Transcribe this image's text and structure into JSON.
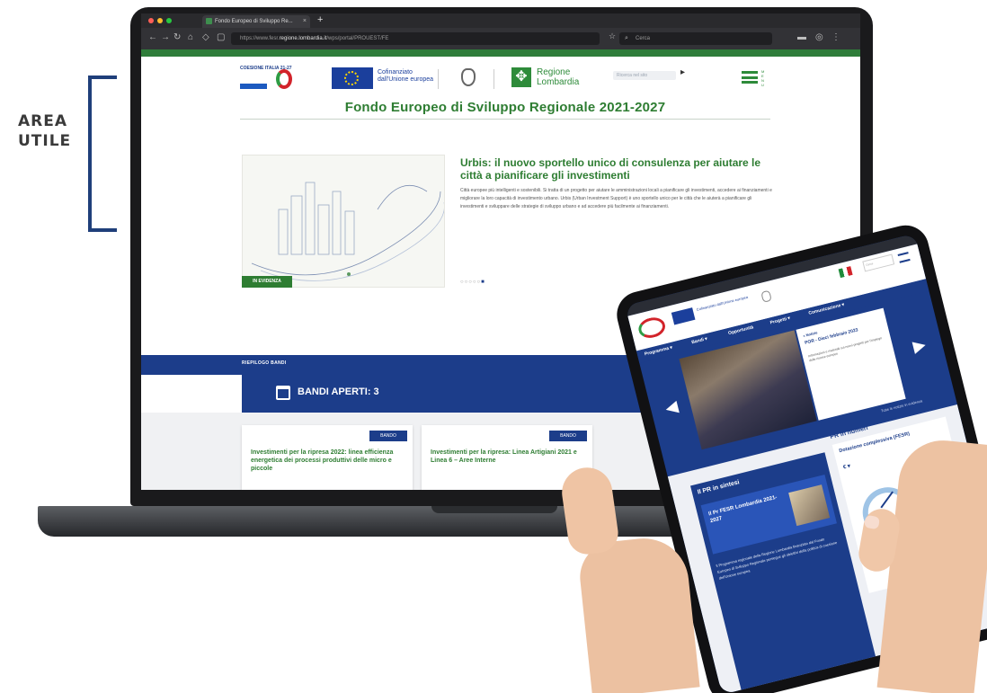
{
  "annotation": {
    "label_line1": "AREA",
    "label_line2": "UTILE"
  },
  "browser": {
    "tab_title": "Fondo Europeo di Sviluppo Re...",
    "tab_close": "×",
    "new_tab": "+",
    "url_prefix": "https://www.fesr.",
    "url_domain": "regione.lombardia.it",
    "url_path": "/wps/portal/PROUEST/FE",
    "search_placeholder": "Cerca"
  },
  "site": {
    "coesione_logo_text": "COESIONE ITALIA 21-27",
    "eu_logo_text_line1": "Cofinanziato",
    "eu_logo_text_line2": "dall'Unione europea",
    "lombardia_line1": "Regione",
    "lombardia_line2": "Lombardia",
    "search_placeholder": "Ricerca nel sito",
    "menu_label": "MENU",
    "page_title": "Fondo Europeo di Sviluppo Regionale 2021-2027",
    "hero_badge": "IN EVIDENZA",
    "hero_title": "Urbis: il nuovo sportello unico di consulenza per aiutare le città a pianificare gli investimenti",
    "hero_text": "Città europee più intelligenti e sostenibili. Si tratta di un progetto per aiutare le amministrazioni locali a pianificare gli investimenti, accedere ai finanziamenti e migliorare la loro capacità di investimento urbano. Urbis (Urban Investment Support) è uno sportello unico per le città che le aiuterà a pianificare gli investimenti e sviluppare delle strategie di sviluppo urbano e ad accedere più facilmente ai finanziamenti.",
    "hero_dots": "○○○○○",
    "hero_dot_active": "■",
    "riepilogo_label": "RIEPILOGO BANDI",
    "bandi_label": "BANDI APERTI: 3",
    "cards": [
      {
        "tag": "BANDO",
        "title": "Investimenti per la ripresa 2022: linea efficienza energetica dei processi produttivi delle micro e piccole"
      },
      {
        "tag": "BANDO",
        "title": "Investimenti per la ripresa: Linea Artigiani 2021 e Linea 6 – Aree Interne"
      }
    ]
  },
  "tablet": {
    "eu_text": "Cofinanziato dall'Unione europea",
    "search_placeholder": "Cerca",
    "nav": [
      "Programma ▾",
      "Bandi ▾",
      "Opportunità",
      "Progetti ▾",
      "Comunicazione ▾"
    ],
    "hero_kicker": "« Notizie",
    "hero_head": "POR - Dieci febbraio 2023",
    "hero_body": "Informazioni e materiali sui nuovi progetti per l'impiego delle risorse europee",
    "arrow_left": "◀",
    "arrow_right": "▶",
    "link_all": "Tutte le notizie in evidenza",
    "pr_title": "Il PR in sintesi",
    "pr_card_title": "Il Pr FESR Lombardia 2021-2027",
    "pr_text": "Il Programma regionale della Regione Lombardia finanziato dal Fondo Europeo di Sviluppo Regionale persegue gli obiettivi della politica di coesione dell'Unione europea",
    "num_title": "PR in numeri",
    "num_sub": "Dotazione complessiva (FESR)",
    "num_value": "€ ▾"
  }
}
